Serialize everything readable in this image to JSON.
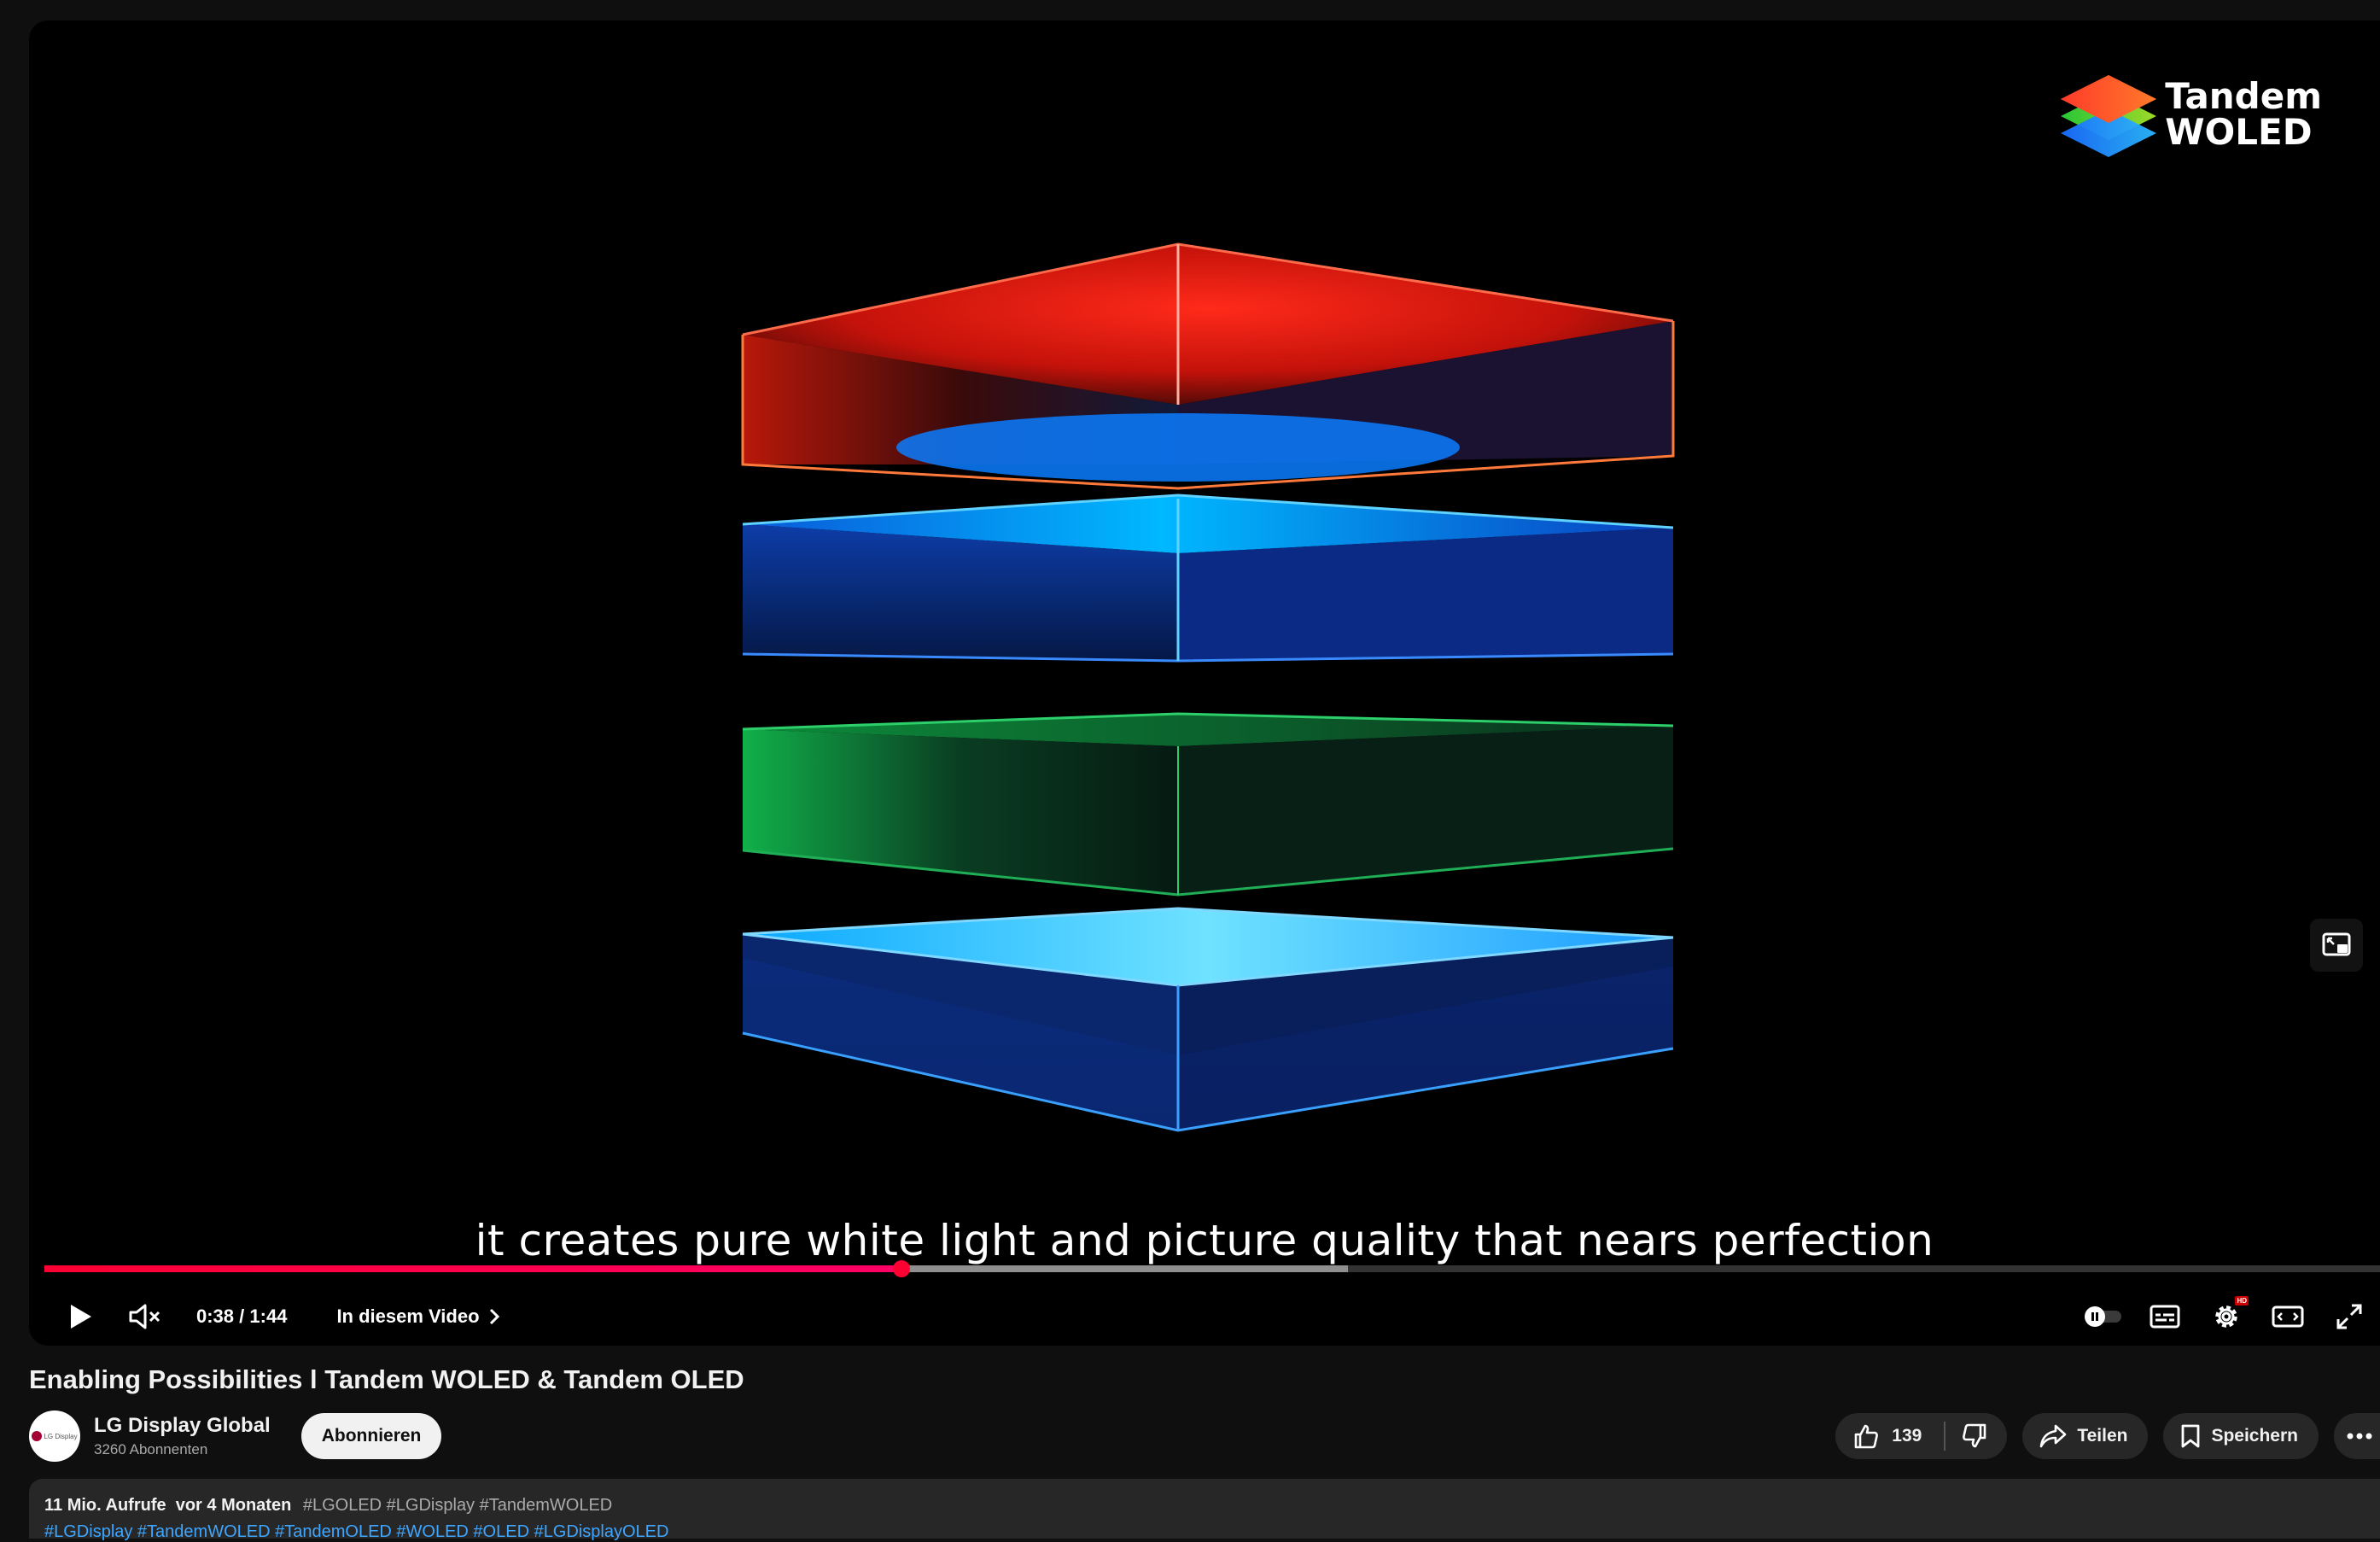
{
  "player": {
    "brand_line1": "Tandem",
    "brand_line2": "WOLED",
    "caption": "it creates pure white light and picture quality that nears perfection",
    "current_time": "0:38",
    "duration": "1:44",
    "time_separator": " / ",
    "progress_played_fraction": 0.367,
    "progress_buffered_fraction": 0.558,
    "chapters_label": "In diesem Video",
    "settings_badge": "HD",
    "icons": [
      "play-icon",
      "mute-icon",
      "chevron-right-icon",
      "autoplay-toggle-icon",
      "subtitles-icon",
      "settings-icon",
      "theater-icon",
      "fullscreen-icon",
      "miniplayer-icon"
    ],
    "accent_color": "#ff0033"
  },
  "video": {
    "title": "Enabling Possibilities l Tandem WOLED & Tandem OLED"
  },
  "channel": {
    "name": "LG Display Global",
    "subscribers": "3260 Abonnenten",
    "avatar_text": "LG Display"
  },
  "actions": {
    "subscribe": "Abonnieren",
    "like_count": "139",
    "share": "Teilen",
    "save": "Speichern"
  },
  "description": {
    "views_date": "11 Mio. Aufrufe  vor 4 Monaten",
    "hashtags": "#LGOLED #LGDisplay #TandemWOLED",
    "hashtags_line2": "#LGDisplay #TandemWOLED #TandemOLED #WOLED #OLED #LGDisplayOLED"
  }
}
